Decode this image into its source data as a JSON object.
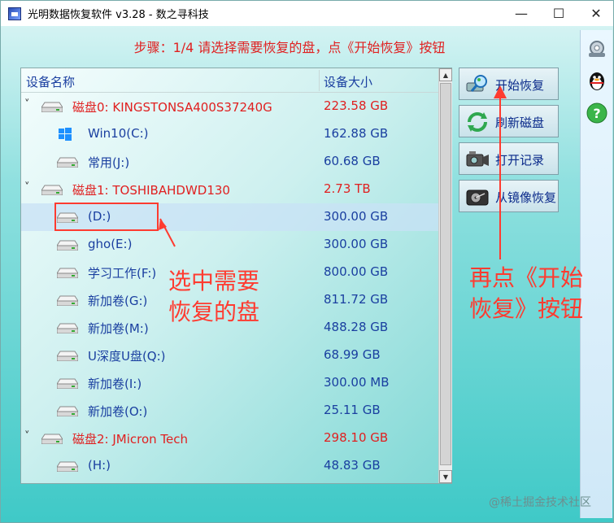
{
  "window": {
    "title": "光明数据恢复软件 v3.28 - 数之寻科技",
    "controls": [
      "minimize-icon",
      "maximize-icon",
      "close-icon"
    ]
  },
  "step_text": "步骤：1/4 请选择需要恢复的盘，点《开始恢复》按钮",
  "device_list": {
    "headers": {
      "name": "设备名称",
      "size": "设备大小"
    },
    "rows": [
      {
        "kind": "disk",
        "name": "磁盘0: KINGSTONSA400S37240G",
        "size": "223.58 GB",
        "toggle": "v"
      },
      {
        "kind": "part",
        "name": "Win10(C:)",
        "size": "162.88 GB",
        "icon": "windows-icon"
      },
      {
        "kind": "part",
        "name": "常用(J:)",
        "size": "60.68 GB"
      },
      {
        "kind": "disk",
        "name": "磁盘1: TOSHIBAHDWD130",
        "size": "2.73 TB",
        "toggle": "v"
      },
      {
        "kind": "part",
        "name": "(D:)",
        "size": "300.00 GB",
        "selected": true
      },
      {
        "kind": "part",
        "name": "gho(E:)",
        "size": "300.00 GB"
      },
      {
        "kind": "part",
        "name": "学习工作(F:)",
        "size": "800.00 GB"
      },
      {
        "kind": "part",
        "name": "新加卷(G:)",
        "size": "811.72 GB"
      },
      {
        "kind": "part",
        "name": "新加卷(M:)",
        "size": "488.28 GB"
      },
      {
        "kind": "part",
        "name": "U深度U盘(Q:)",
        "size": "68.99 GB"
      },
      {
        "kind": "part",
        "name": "新加卷(I:)",
        "size": "300.00 MB"
      },
      {
        "kind": "part",
        "name": "新加卷(O:)",
        "size": "25.11 GB"
      },
      {
        "kind": "disk",
        "name": "磁盘2: JMicron  Tech",
        "size": "298.10 GB",
        "toggle": "v"
      },
      {
        "kind": "part",
        "name": "(H:)",
        "size": "48.83 GB"
      }
    ]
  },
  "buttons": [
    {
      "label": "开始恢复",
      "icon": "magnifier-disk-icon"
    },
    {
      "label": "刷新磁盘",
      "icon": "refresh-icon"
    },
    {
      "label": "打开记录",
      "icon": "camera-icon"
    },
    {
      "label": "从镜像恢复",
      "icon": "hard-disk-icon"
    }
  ],
  "annotations": {
    "select_line1": "选中需要",
    "select_line2": "恢复的盘",
    "click_line1": "再点《开始",
    "click_line2": "恢复》按钮"
  },
  "watermark": "@稀土掘金技术社区",
  "colors": {
    "accent_red": "#e02020",
    "text_blue": "#1a3fa0",
    "annotation_red": "#ff3b30"
  }
}
